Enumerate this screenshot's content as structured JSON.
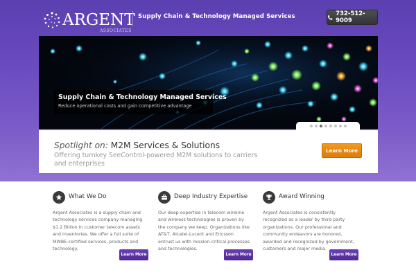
{
  "brand": {
    "name": "ARGENT",
    "sub": "ASSOCIATES",
    "tagline": "Supply Chain & Technology Managed Services"
  },
  "contact": {
    "phone": "732-512-9009",
    "icon": "phone-icon"
  },
  "slider": {
    "caption_title": "Supply Chain & Technology Managed Services",
    "caption_sub": "Reduce operational costs and gain competitive advantage",
    "slides": 8,
    "active_slide": 3
  },
  "spotlight": {
    "lead": "Spotlight on:",
    "title": "M2M Services & Solutions",
    "description": "Offering turnkey SeeControl-powered M2M solutions to carriers and enterprises",
    "button": "Learn More"
  },
  "features": [
    {
      "icon": "star-icon",
      "title": "What We Do",
      "body": "Argent Associates is a supply chain and technology services company managing $1.2 Billion in customer telecom assets and inventories. We offer a full suite of MWBE-certified services, products and technology.",
      "button": "Learn More"
    },
    {
      "icon": "briefcase-icon",
      "title": "Deep Industry Expertise",
      "body": "Our deep expertise in telecom wireline and wireless technologies is proven by the company we keep. Organizations like AT&T, Alcatel-Lucent and Ericsson entrust us with mission-critical processes and technologies.",
      "button": "Learn More"
    },
    {
      "icon": "trophy-icon",
      "title": "Award Winning",
      "body": "Argent Associates is consistently recognized as a leader by third party organizations. Our professional and community endeavors are honored, awarded and recognized by government, customers and major media.",
      "button": "Learn More"
    }
  ],
  "colors": {
    "header_gradient_top": "#5b3fb0",
    "header_gradient_bottom": "#8f72d2",
    "orange_button": "#e07a0c",
    "purple_button": "#4f2a94"
  }
}
